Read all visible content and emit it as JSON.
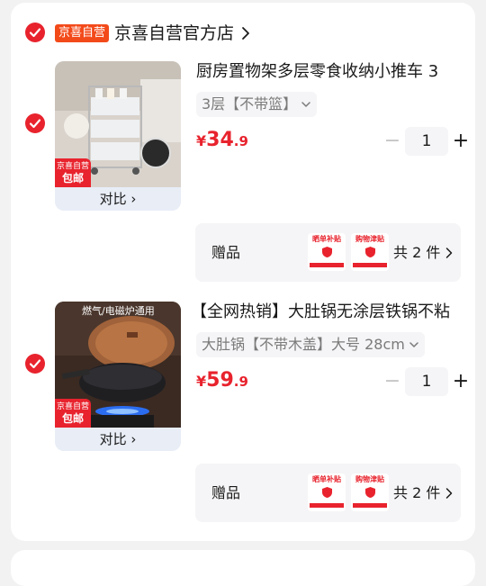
{
  "store": {
    "badge": "京喜自营",
    "name": "京喜自营官方店"
  },
  "items": [
    {
      "title": "厨房置物架多层零食收纳小推车 3",
      "spec": "3层【不带篮】",
      "price_currency": "¥",
      "price_int": "34",
      "price_dec": ".9",
      "quantity": "1",
      "thumb_tag_top": "京喜自营",
      "thumb_tag_bottom": "包邮",
      "compare_label": "对比 ›",
      "gift": {
        "label": "赠品",
        "gift1": "晒单补贴",
        "gift2": "购物津贴",
        "count_text": "共 2 件"
      }
    },
    {
      "title": "【全网热销】大肚锅无涂层铁锅不粘",
      "spec": "大肚锅【不带木盖】大号 28cm",
      "price_currency": "¥",
      "price_int": "59",
      "price_dec": ".9",
      "quantity": "1",
      "thumb_tag_top": "京喜自营",
      "thumb_tag_bottom": "包邮",
      "compare_label": "对比 ›",
      "thumb_caption": "燃气/电磁炉通用",
      "gift": {
        "label": "赠品",
        "gift1": "晒单补贴",
        "gift2": "购物津贴",
        "count_text": "共 2 件"
      }
    }
  ],
  "colors": {
    "accent": "#e8232d",
    "badge": "#f34a1a",
    "panel": "#f5f5f7",
    "background": "#f2f2f2"
  },
  "icons": [
    "check-icon",
    "chevron-right-icon",
    "chevron-down-icon",
    "minus-icon",
    "plus-icon"
  ]
}
